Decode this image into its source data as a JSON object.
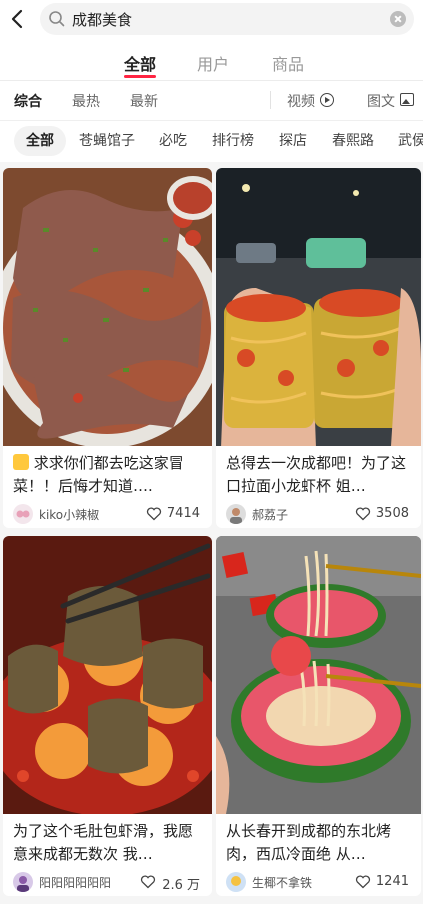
{
  "search": {
    "query": "成都美食"
  },
  "tabs": [
    {
      "label": "全部",
      "active": true
    },
    {
      "label": "用户",
      "active": false
    },
    {
      "label": "商品",
      "active": false
    }
  ],
  "sort": {
    "items": [
      "综合",
      "最热",
      "最新"
    ],
    "video_label": "视频",
    "image_label": "图文"
  },
  "chips": [
    "全部",
    "苍蝇馆子",
    "必吃",
    "排行榜",
    "探店",
    "春熙路",
    "武侯"
  ],
  "colors": {
    "accent": "#ff2442"
  },
  "cards": [
    {
      "title": "求求你们都去吃这家冒菜！！后悔才知道….",
      "title_prefix_icon": "crying-face-emoji",
      "author": "kiko小辣椒",
      "likes": "7414"
    },
    {
      "title": "总得去一次成都吧！为了这口拉面小龙虾杯 姐…",
      "author": "郝荔子",
      "likes": "3508"
    },
    {
      "title": "为了这个毛肚包虾滑，我愿意来成都无数次 我…",
      "author": "阳阳阳阳阳阳",
      "likes": "2.6 万"
    },
    {
      "title": "从长春开到成都的东北烤肉，西瓜冷面绝 从…",
      "author": "生椰不拿铁",
      "likes": "1241"
    }
  ]
}
